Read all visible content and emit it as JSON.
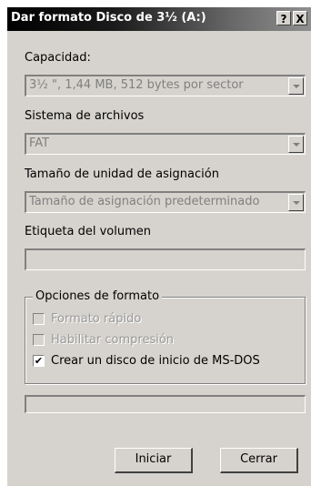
{
  "window": {
    "title": "Dar formato Disco de 3½ (A:)",
    "help_button": "?",
    "close_button": "X"
  },
  "capacity": {
    "label": "Capacidad:",
    "value": "3½ \", 1,44 MB, 512 bytes por sector"
  },
  "filesystem": {
    "label": "Sistema de archivos",
    "value": "FAT"
  },
  "allocation": {
    "label": "Tamaño de unidad de asignación",
    "value": "Tamaño de asignación predeterminado"
  },
  "volume_label": {
    "label": "Etiqueta del volumen",
    "value": ""
  },
  "format_options": {
    "title": "Opciones de formato",
    "quick_format": {
      "label": "Formato rápido",
      "checked": false,
      "enabled": false
    },
    "compression": {
      "label": "Habilitar compresión",
      "checked": false,
      "enabled": false
    },
    "msdos_boot": {
      "label": "Crear un disco de inicio de MS-DOS",
      "checked": true,
      "enabled": true,
      "mark": "✔"
    }
  },
  "progress": {
    "value": 0
  },
  "buttons": {
    "start": "Iniciar",
    "close": "Cerrar"
  },
  "colors": {
    "face": "#d6d3ce",
    "title_gradient_start": "#000000",
    "title_gradient_end": "#8f8f8f",
    "disabled_text": "#808080"
  }
}
